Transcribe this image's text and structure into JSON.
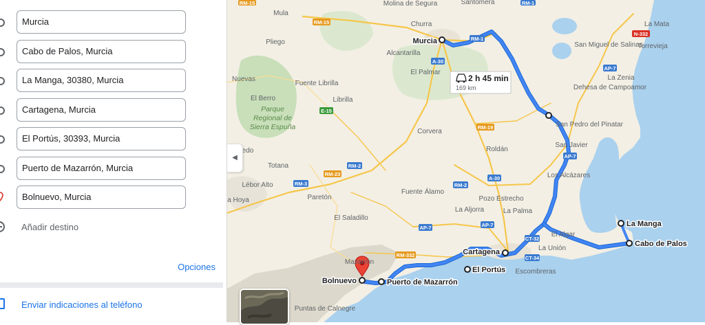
{
  "panel": {
    "stops": [
      {
        "value": "Murcia",
        "kind": "waypoint"
      },
      {
        "value": "Cabo de Palos, Murcia",
        "kind": "waypoint"
      },
      {
        "value": "La Manga, 30380, Murcia",
        "kind": "waypoint"
      },
      {
        "value": "Cartagena, Murcia",
        "kind": "waypoint"
      },
      {
        "value": "El Portús, 30393, Murcia",
        "kind": "waypoint"
      },
      {
        "value": "Puerto de Mazarrón, Murcia",
        "kind": "waypoint"
      },
      {
        "value": "Bolnuevo, Murcia",
        "kind": "destination"
      }
    ],
    "add_destination": "Añadir destino",
    "options": "Opciones",
    "send_to_phone": "Enviar indicaciones al teléfono"
  },
  "route": {
    "duration": "2 h 45 min",
    "distance": "169 km",
    "color": "#4285f4",
    "stop_labels": [
      "Murcia",
      "La Manga",
      "Cabo de Palos",
      "Cartagena",
      "El Portús",
      "Puerto de Mazarrón",
      "Bolnuevo"
    ]
  },
  "map": {
    "places": [
      "Molina de Segura",
      "Santomera",
      "Mula",
      "Churra",
      "Alcantarilla",
      "Pliego",
      "El Palmar",
      "Fuente Librilla",
      "Librilla",
      "El Berro",
      "Corvera",
      "Roldán",
      "Totana",
      "Lébor Alto",
      "Paretón",
      "Fuente Álamo",
      "Pozo Estrecho",
      "La Palma",
      "La Aljorra",
      "El Saladillo",
      "El Algar",
      "La Unión",
      "Escombreras",
      "Mazarrón",
      "Puntas de Calnegre",
      "La Mata",
      "Torrevieja",
      "San Miguel de Salinas",
      "La Zenia",
      "Dehesa de Campoamor",
      "San Pedro del Pinatar",
      "San Javier",
      "Los Alcázares",
      "Nuevas",
      "edo",
      "a Hoya"
    ],
    "park": [
      "Parque",
      "Regional de",
      "Sierra Espuña"
    ],
    "roads": [
      "RM-15",
      "RM-1",
      "A-30",
      "E-15",
      "RM-19",
      "RM-2",
      "RM-23",
      "RM-3",
      "A-30",
      "RM-2",
      "AP-7",
      "AP-7",
      "AP-7",
      "RM-332",
      "CT-32",
      "CT-34",
      "N-332",
      "AP-7",
      "RM-15",
      "RM-1"
    ]
  }
}
